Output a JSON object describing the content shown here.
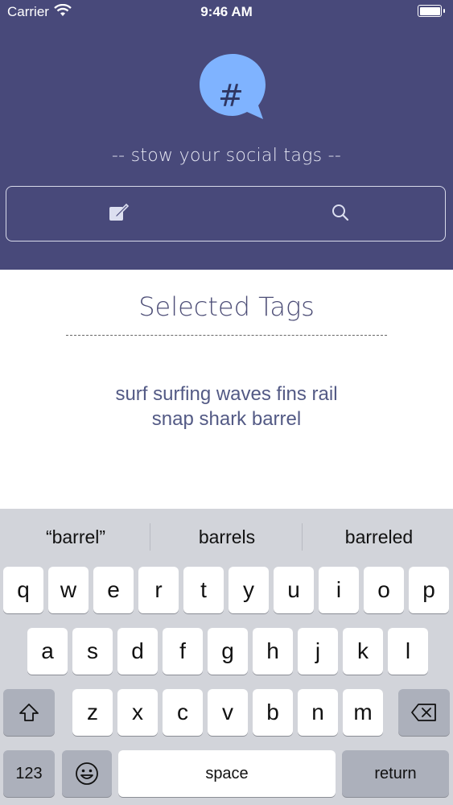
{
  "status_bar": {
    "carrier": "Carrier",
    "time": "9:46 AM"
  },
  "header": {
    "logo_symbol": "#",
    "tagline": "-- stow your social tags --",
    "edit_icon": "compose-icon",
    "search_icon": "search-icon",
    "colors": {
      "background": "#48497a",
      "logo": "#7fb3ff"
    }
  },
  "main": {
    "title": "Selected Tags",
    "tags_line1": "surf surfing waves fins rail",
    "tags_line2": "snap shark barrel"
  },
  "keyboard": {
    "suggestions": [
      "“barrel”",
      "barrels",
      "barreled"
    ],
    "row1": [
      "q",
      "w",
      "e",
      "r",
      "t",
      "y",
      "u",
      "i",
      "o",
      "p"
    ],
    "row2": [
      "a",
      "s",
      "d",
      "f",
      "g",
      "h",
      "j",
      "k",
      "l"
    ],
    "row3": [
      "z",
      "x",
      "c",
      "v",
      "b",
      "n",
      "m"
    ],
    "numbers_label": "123",
    "space_label": "space",
    "return_label": "return",
    "shift_icon": "shift-icon",
    "delete_icon": "delete-icon",
    "emoji_icon": "emoji-icon"
  }
}
